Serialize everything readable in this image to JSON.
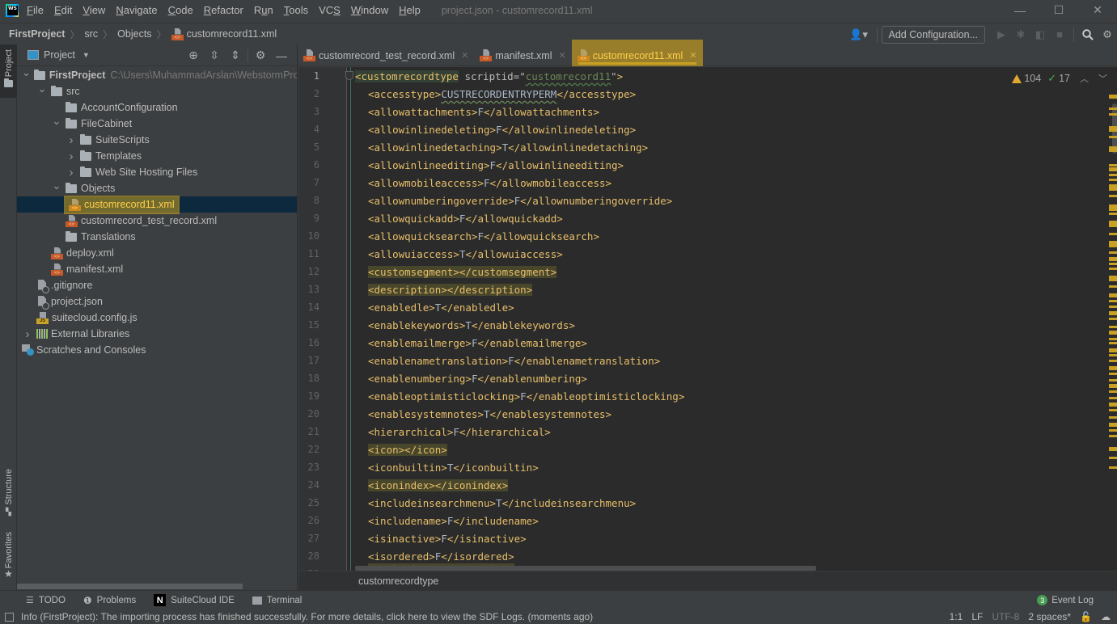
{
  "menubar": {
    "items": [
      {
        "mnemonic": "F",
        "rest": "ile"
      },
      {
        "mnemonic": "E",
        "rest": "dit"
      },
      {
        "mnemonic": "V",
        "rest": "iew"
      },
      {
        "mnemonic": "N",
        "rest": "avigate"
      },
      {
        "mnemonic": "C",
        "rest": "ode"
      },
      {
        "mnemonic": "R",
        "rest": "efactor"
      },
      {
        "pre": "R",
        "mnemonic": "u",
        "rest": "n"
      },
      {
        "mnemonic": "T",
        "rest": "ools"
      },
      {
        "pre": "VC",
        "mnemonic": "S",
        "rest": ""
      },
      {
        "mnemonic": "W",
        "rest": "indow"
      },
      {
        "mnemonic": "H",
        "rest": "elp"
      }
    ],
    "window_title": "project.json - customrecord11.xml",
    "controls": {
      "minimize": "—",
      "maximize": "☐",
      "close": "✕"
    }
  },
  "navbar": {
    "breadcrumb": [
      "FirstProject",
      "src",
      "Objects",
      "customrecord11.xml"
    ],
    "add_configuration": "Add Configuration...",
    "icons": [
      "user-icon",
      "run-icon",
      "debug-icon",
      "coverage-icon",
      "stop-icon",
      "search-icon",
      "settings-icon"
    ]
  },
  "left_strip": {
    "project": "Project",
    "structure": "Structure",
    "favorites": "Favorites"
  },
  "project_panel": {
    "title": "Project",
    "tree": [
      {
        "label": "FirstProject",
        "hint": "C:\\Users\\MuhammadArslan\\WebstormProjects\\FirstProject",
        "depth": 0,
        "type": "folder",
        "expanded": true,
        "bold": true
      },
      {
        "label": "src",
        "depth": 1,
        "type": "folder",
        "expanded": true
      },
      {
        "label": "AccountConfiguration",
        "depth": 2,
        "type": "folder"
      },
      {
        "label": "FileCabinet",
        "depth": 2,
        "type": "folder",
        "expanded": true
      },
      {
        "label": "SuiteScripts",
        "depth": 3,
        "type": "folder",
        "expanded": false
      },
      {
        "label": "Templates",
        "depth": 3,
        "type": "folder",
        "expanded": false
      },
      {
        "label": "Web Site Hosting Files",
        "depth": 3,
        "type": "folder",
        "expanded": false
      },
      {
        "label": "Objects",
        "depth": 2,
        "type": "folder",
        "expanded": true
      },
      {
        "label": "customrecord11.xml",
        "depth": 3,
        "type": "xml",
        "selected": true
      },
      {
        "label": "customrecord_test_record.xml",
        "depth": 3,
        "type": "xml"
      },
      {
        "label": "Translations",
        "depth": 2,
        "type": "folder"
      },
      {
        "label": "deploy.xml",
        "depth": 2,
        "type": "xml"
      },
      {
        "label": "manifest.xml",
        "depth": 2,
        "type": "xml"
      },
      {
        "label": ".gitignore",
        "depth": 1,
        "type": "generic"
      },
      {
        "label": "project.json",
        "depth": 1,
        "type": "generic"
      },
      {
        "label": "suitecloud.config.js",
        "depth": 1,
        "type": "js"
      },
      {
        "label": "External Libraries",
        "depth": 0,
        "type": "library",
        "expanded": false
      },
      {
        "label": "Scratches and Consoles",
        "depth": 0,
        "type": "scratch"
      }
    ]
  },
  "tabs": [
    {
      "label": "customrecord_test_record.xml",
      "active": false
    },
    {
      "label": "manifest.xml",
      "active": false
    },
    {
      "label": "customrecord11.xml",
      "active": true
    }
  ],
  "editor": {
    "inspection": {
      "warnings": "104",
      "typos": "17"
    },
    "lines": [
      {
        "n": "1",
        "tag": "customrecordtype",
        "attr": "scriptid",
        "attr_value": "customrecord11",
        "open_only": true
      },
      {
        "n": "2",
        "tag": "accesstype",
        "value": "CUSTRECORDENTRYPERM"
      },
      {
        "n": "3",
        "tag": "allowattachments",
        "value": "F"
      },
      {
        "n": "4",
        "tag": "allowinlinedeleting",
        "value": "F"
      },
      {
        "n": "5",
        "tag": "allowinlinedetaching",
        "value": "T"
      },
      {
        "n": "6",
        "tag": "allowinlineediting",
        "value": "F"
      },
      {
        "n": "7",
        "tag": "allowmobileaccess",
        "value": "F"
      },
      {
        "n": "8",
        "tag": "allownumberingoverride",
        "value": "F"
      },
      {
        "n": "9",
        "tag": "allowquickadd",
        "value": "F"
      },
      {
        "n": "10",
        "tag": "allowquicksearch",
        "value": "F"
      },
      {
        "n": "11",
        "tag": "allowuiaccess",
        "value": "T"
      },
      {
        "n": "12",
        "tag": "customsegment",
        "value": ""
      },
      {
        "n": "13",
        "tag": "description",
        "value": ""
      },
      {
        "n": "14",
        "tag": "enabledle",
        "value": "T"
      },
      {
        "n": "15",
        "tag": "enablekeywords",
        "value": "T"
      },
      {
        "n": "16",
        "tag": "enablemailmerge",
        "value": "F"
      },
      {
        "n": "17",
        "tag": "enablenametranslation",
        "value": "F"
      },
      {
        "n": "18",
        "tag": "enablenumbering",
        "value": "F"
      },
      {
        "n": "19",
        "tag": "enableoptimisticlocking",
        "value": "F"
      },
      {
        "n": "20",
        "tag": "enablesystemnotes",
        "value": "T"
      },
      {
        "n": "21",
        "tag": "hierarchical",
        "value": "F"
      },
      {
        "n": "22",
        "tag": "icon",
        "value": ""
      },
      {
        "n": "23",
        "tag": "iconbuiltin",
        "value": "T"
      },
      {
        "n": "24",
        "tag": "iconindex",
        "value": ""
      },
      {
        "n": "25",
        "tag": "includeinsearchmenu",
        "value": "T"
      },
      {
        "n": "26",
        "tag": "includename",
        "value": "F"
      },
      {
        "n": "27",
        "tag": "isinactive",
        "value": "F"
      },
      {
        "n": "28",
        "tag": "isordered",
        "value": "F"
      }
    ],
    "breadcrumb": "customrecordtype"
  },
  "tool_windows": {
    "todo": "TODO",
    "problems": "Problems",
    "suitecloud": "SuiteCloud IDE",
    "terminal": "Terminal",
    "event_log": "Event Log",
    "event_count": "3"
  },
  "statusbar": {
    "message": "Info (FirstProject): The importing process has finished successfully. For more details, click here to view the SDF Logs. (moments ago)",
    "position": "1:1",
    "line_separator": "LF",
    "encoding": "UTF-8",
    "indent": "2 spaces*"
  },
  "colors": {
    "highlight": "#c9a021",
    "tag": "#e8bf6a",
    "text_value": "#a9b7c6",
    "attr_value": "#6a8759",
    "editor_bg": "#2b2b2b",
    "panel_bg": "#3c3f41",
    "selection": "#0d293e"
  }
}
